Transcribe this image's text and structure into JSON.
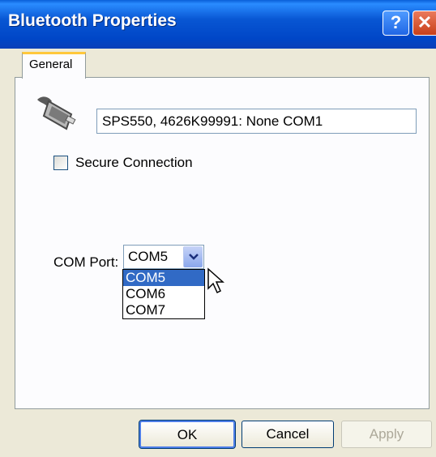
{
  "window": {
    "title": "Bluetooth Properties",
    "help_label": "?",
    "close_label": "✕"
  },
  "tabs": [
    {
      "label": "General"
    }
  ],
  "device": {
    "icon": "serial-port-icon",
    "name": "SPS550, 4626K99991: None COM1"
  },
  "secure_connection": {
    "label": "Secure Connection",
    "checked": false
  },
  "com_port": {
    "label": "COM Port:",
    "selected": "COM5",
    "options": [
      "COM5",
      "COM6",
      "COM7"
    ]
  },
  "buttons": {
    "ok": "OK",
    "cancel": "Cancel",
    "apply": "Apply"
  },
  "colors": {
    "titlebar": "#0046c7",
    "selection": "#316ac5",
    "tab_highlight": "#ffc83c",
    "close": "#c8401a"
  }
}
